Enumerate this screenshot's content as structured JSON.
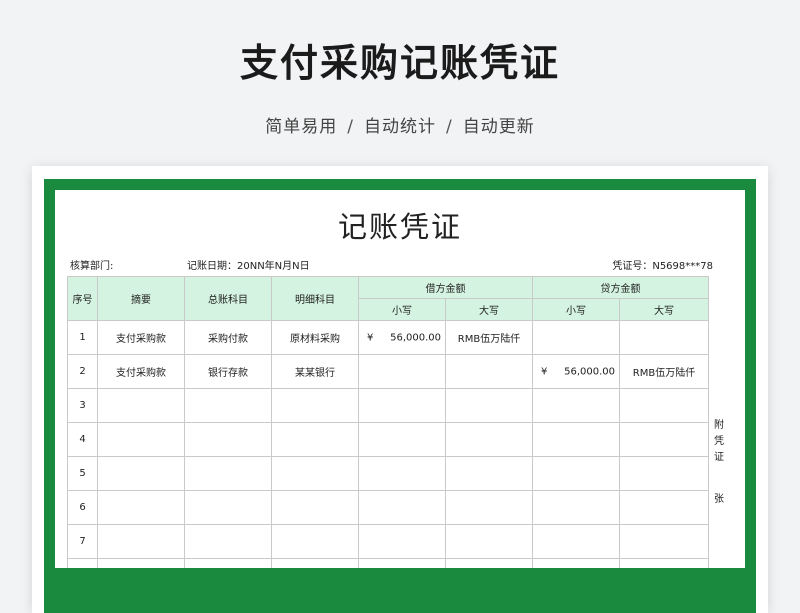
{
  "page": {
    "title": "支付采购记账凭证",
    "subtitle_parts": [
      "简单易用",
      "自动统计",
      "自动更新"
    ],
    "separator": "/"
  },
  "voucher": {
    "title": "记账凭证",
    "dept_label": "核算部门:",
    "date_label": "记账日期：20NN年N月N日",
    "number_label": "凭证号：N5698***78",
    "headers": {
      "seq": "序号",
      "summary": "摘要",
      "general_account": "总账科目",
      "detail_account": "明细科目",
      "debit": "借方金额",
      "credit": "贷方金额",
      "small": "小写",
      "big": "大写"
    },
    "rows": [
      {
        "seq": "1",
        "summary": "支付采购款",
        "general": "采购付款",
        "detail": "原材料采购",
        "debit_yen": "¥",
        "debit_small": "56,000.00",
        "debit_big": "RMB伍万陆仟",
        "credit_yen": "",
        "credit_small": "",
        "credit_big": ""
      },
      {
        "seq": "2",
        "summary": "支付采购款",
        "general": "银行存款",
        "detail": "某某银行",
        "debit_yen": "",
        "debit_small": "",
        "debit_big": "",
        "credit_yen": "¥",
        "credit_small": "56,000.00",
        "credit_big": "RMB伍万陆仟"
      },
      {
        "seq": "3",
        "summary": "",
        "general": "",
        "detail": "",
        "debit_yen": "",
        "debit_small": "",
        "debit_big": "",
        "credit_yen": "",
        "credit_small": "",
        "credit_big": ""
      },
      {
        "seq": "4",
        "summary": "",
        "general": "",
        "detail": "",
        "debit_yen": "",
        "debit_small": "",
        "debit_big": "",
        "credit_yen": "",
        "credit_small": "",
        "credit_big": ""
      },
      {
        "seq": "5",
        "summary": "",
        "general": "",
        "detail": "",
        "debit_yen": "",
        "debit_small": "",
        "debit_big": "",
        "credit_yen": "",
        "credit_small": "",
        "credit_big": ""
      },
      {
        "seq": "6",
        "summary": "",
        "general": "",
        "detail": "",
        "debit_yen": "",
        "debit_small": "",
        "debit_big": "",
        "credit_yen": "",
        "credit_small": "",
        "credit_big": ""
      },
      {
        "seq": "7",
        "summary": "",
        "general": "",
        "detail": "",
        "debit_yen": "",
        "debit_small": "",
        "debit_big": "",
        "credit_yen": "",
        "credit_small": "",
        "credit_big": ""
      },
      {
        "seq": "",
        "summary": "",
        "general": "",
        "detail": "",
        "debit_yen": "",
        "debit_small": "",
        "debit_big": "",
        "credit_yen": "",
        "credit_small": "",
        "credit_big": ""
      }
    ],
    "attachment_chars": [
      "附",
      "凭",
      "证",
      "张"
    ]
  },
  "colors": {
    "frame_green": "#1a8a3e",
    "header_fill": "#d4f3e0"
  }
}
